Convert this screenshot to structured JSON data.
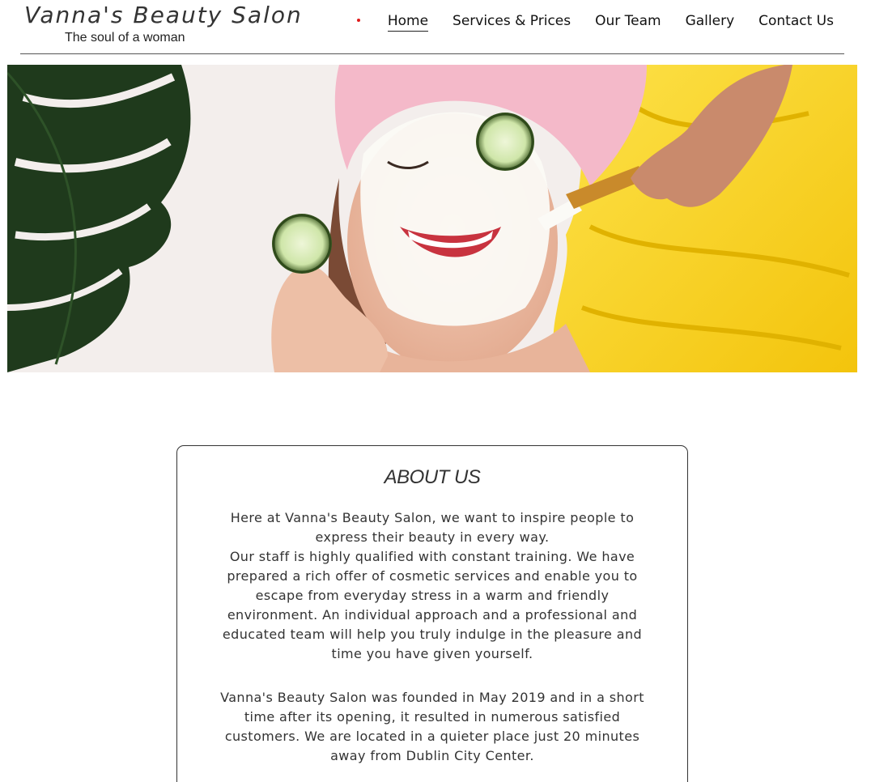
{
  "brand": {
    "title": "Vanna's Beauty Salon",
    "tagline": "The soul of a woman"
  },
  "nav": {
    "items": [
      {
        "label": "Home",
        "active": true
      },
      {
        "label": "Services & Prices",
        "active": false
      },
      {
        "label": "Our Team",
        "active": false
      },
      {
        "label": "Gallery",
        "active": false
      },
      {
        "label": "Contact Us",
        "active": false
      }
    ]
  },
  "colors": {
    "accent_dot": "#e01b1b",
    "towel_pink": "#f4b9c9",
    "towel_yellow": "#f7d21a",
    "leaf_green": "#1f3a1c",
    "cucumber": "#cfe6a9"
  },
  "about": {
    "heading": "ABOUT US",
    "paragraph1": "Here at Vanna's Beauty Salon, we want to inspire people to express their beauty in every way.\nOur staff is highly qualified with constant training. We have prepared a rich offer of cosmetic services and enable you to escape from everyday stress in a warm and friendly environment. An individual approach and a professional and educated team will help you truly indulge in the pleasure and time you have given yourself.",
    "paragraph2": "Vanna's Beauty Salon was founded in May 2019 and in a short time after its opening, it resulted in numerous satisfied customers. We are located in a quieter place just 20 minutes away from Dublin City Center."
  }
}
